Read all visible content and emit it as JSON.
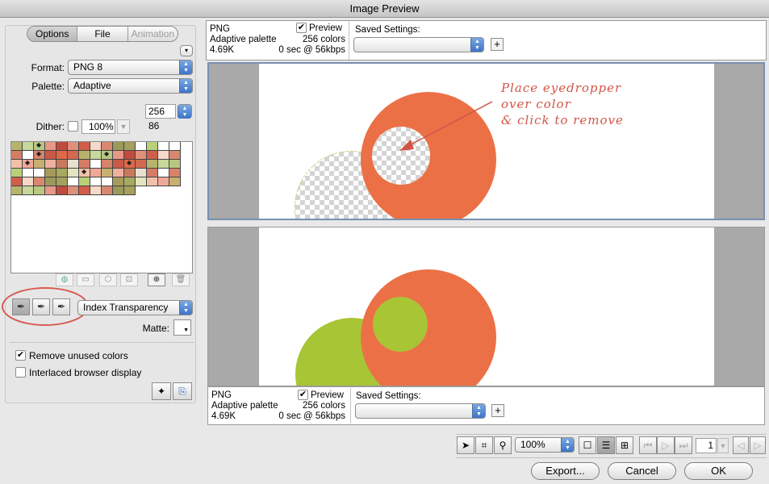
{
  "window": {
    "title": "Image Preview"
  },
  "left_tabs": [
    "Options",
    "File",
    "Animation"
  ],
  "format": {
    "label": "Format:",
    "value": "PNG 8"
  },
  "palette_type": {
    "label": "Palette:",
    "value": "Adaptive"
  },
  "colors": {
    "max": "256",
    "count": "86"
  },
  "dither": {
    "label": "Dither:",
    "value": "100%"
  },
  "palette_colors": [
    "#b7b36b",
    "#ffffff",
    "#d8826a",
    "#9a9a5a",
    "#c97a5c",
    "#e0907a",
    "#f2c0a8",
    "#c8d89a",
    "#ffffff",
    "#c85a48",
    "#a6a05e",
    "#e8e0d0",
    "#d05e48",
    "#f0a898",
    "#b8c880",
    "#a89a58",
    "#e06848",
    "#ffffff",
    "#d47c64",
    "#f8d8c8",
    "#c8b070",
    "#e89888",
    "#a8a860",
    "#d26a50",
    "#b8d078",
    "#ffffff",
    "#d88870",
    "#f0b0a0",
    "#c04c40",
    "#e4e4c0"
  ],
  "transparency": {
    "mode": "Index Transparency",
    "matte_label": "Matte:"
  },
  "options": [
    {
      "label": "Remove unused colors",
      "checked": true
    },
    {
      "label": "Interlaced browser display",
      "checked": false
    }
  ],
  "preview_top": {
    "format": "PNG",
    "palette": "Adaptive palette",
    "size": "4.69K",
    "colors": "256 colors",
    "time": "0 sec @ 56kbps",
    "preview_label": "Preview",
    "saved_label": "Saved Settings:"
  },
  "preview_bottom": {
    "format": "PNG",
    "palette": "Adaptive palette",
    "size": "4.69K",
    "colors": "256 colors",
    "time": "0 sec @ 56kbps",
    "preview_label": "Preview",
    "saved_label": "Saved Settings:"
  },
  "annotation": [
    "Place eyedropper",
    "over color",
    "& click to remove"
  ],
  "image_colors": {
    "orange": "#ec7046",
    "green": "#a8c535"
  },
  "toolbar": {
    "zoom": "100%",
    "frame": "1"
  },
  "buttons": {
    "export": "Export...",
    "cancel": "Cancel",
    "ok": "OK"
  }
}
